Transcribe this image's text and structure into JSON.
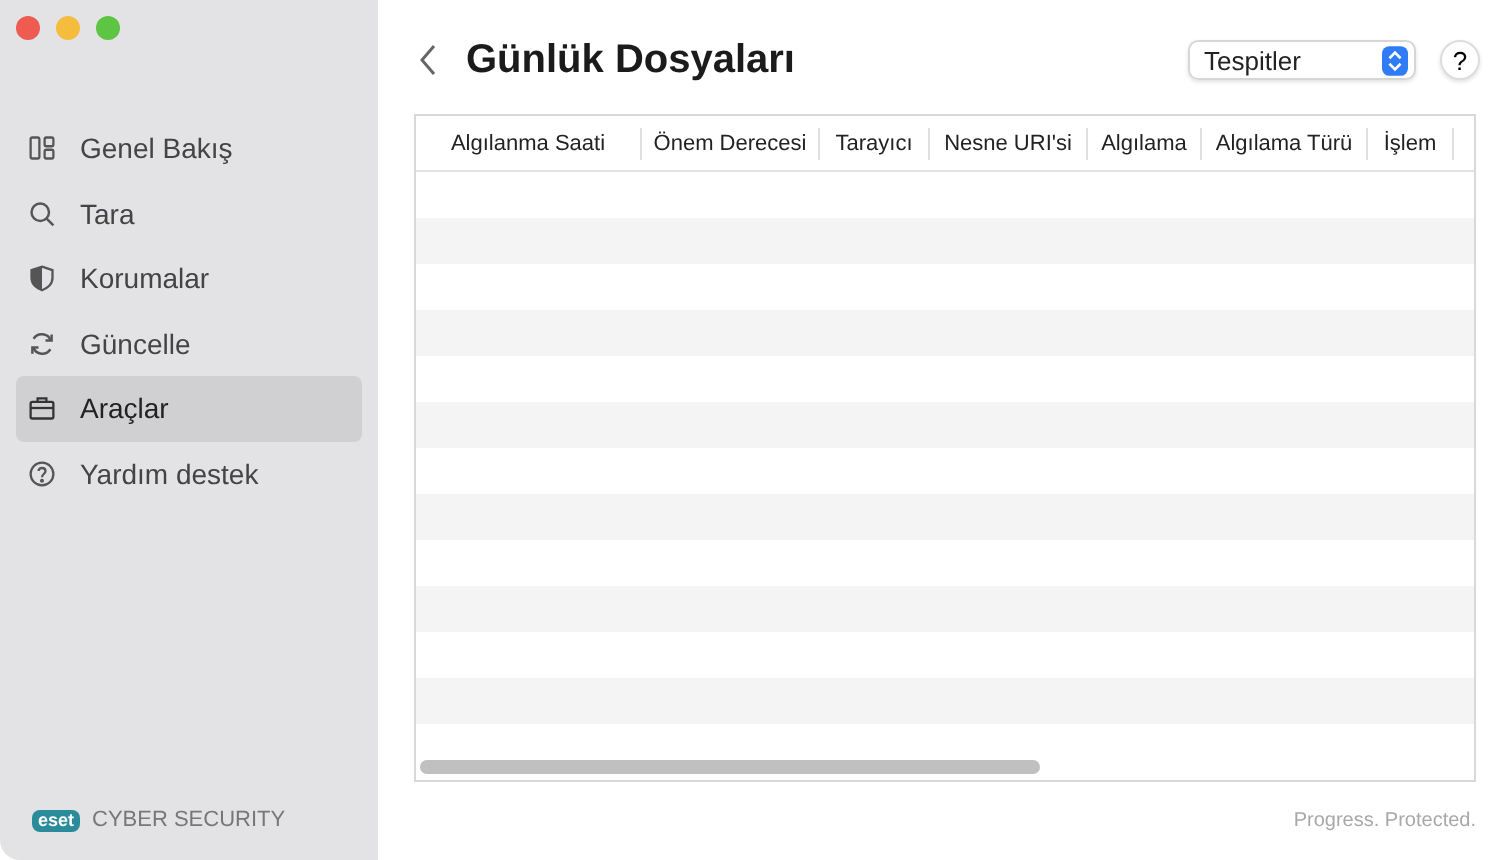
{
  "window": {
    "title": "Günlük Dosyaları"
  },
  "sidebar": {
    "items": [
      {
        "label": "Genel Bakış",
        "kind": "overview",
        "selected": false
      },
      {
        "label": "Tara",
        "kind": "scan",
        "selected": false
      },
      {
        "label": "Korumalar",
        "kind": "shield",
        "selected": false
      },
      {
        "label": "Güncelle",
        "kind": "update",
        "selected": false
      },
      {
        "label": "Araçlar",
        "kind": "tools",
        "selected": true
      },
      {
        "label": "Yardım destek",
        "kind": "help",
        "selected": false
      }
    ],
    "brand_logo": "eset",
    "brand_name": "CYBER SECURITY"
  },
  "log_type_select": {
    "value": "Tespitler"
  },
  "help_button": "?",
  "table": {
    "columns": [
      "Algılanma Saati",
      "Önem Derecesi",
      "Tarayıcı",
      "Nesne URI'si",
      "Algılama",
      "Algılama Türü",
      "İşlem"
    ]
  },
  "footer": "Progress. Protected."
}
